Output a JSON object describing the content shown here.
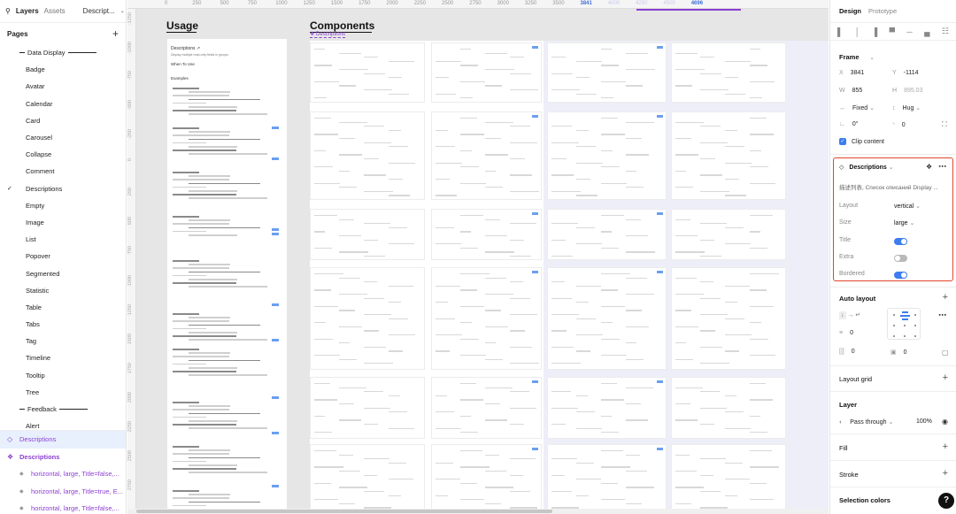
{
  "left_panel": {
    "tabs": {
      "layers": "Layers",
      "assets": "Assets",
      "page": "Descript..."
    },
    "pages_title": "Pages",
    "pages": [
      {
        "label": "Data Display",
        "type": "section"
      },
      {
        "label": "Badge"
      },
      {
        "label": "Avatar"
      },
      {
        "label": "Calendar"
      },
      {
        "label": "Card"
      },
      {
        "label": "Carousel"
      },
      {
        "label": "Collapse"
      },
      {
        "label": "Comment"
      },
      {
        "label": "Descriptions",
        "current": true
      },
      {
        "label": "Empty"
      },
      {
        "label": "Image"
      },
      {
        "label": "List"
      },
      {
        "label": "Popover"
      },
      {
        "label": "Segmented"
      },
      {
        "label": "Statistic"
      },
      {
        "label": "Table"
      },
      {
        "label": "Tabs"
      },
      {
        "label": "Tag"
      },
      {
        "label": "Timeline"
      },
      {
        "label": "Tooltip"
      },
      {
        "label": "Tree"
      },
      {
        "label": "Feedback",
        "type": "section"
      },
      {
        "label": "Alert"
      }
    ],
    "layers": [
      {
        "label": "Descriptions",
        "selected": true,
        "kind": "instance"
      },
      {
        "label": "Descriptions",
        "kind": "component-set"
      },
      {
        "label": "horizontal, large, Title=false,...",
        "kind": "variant"
      },
      {
        "label": "horizontal, large, Title=true, E...",
        "kind": "variant"
      },
      {
        "label": "horizontal, large, Title=false,...",
        "kind": "variant"
      }
    ]
  },
  "canvas": {
    "ruler_ticks": [
      "0",
      "250",
      "500",
      "750",
      "1000",
      "1250",
      "1500",
      "1750",
      "2000",
      "2250",
      "2500",
      "2750",
      "3000",
      "3250",
      "3500",
      "3841",
      "4000",
      "4250",
      "4500",
      "4696"
    ],
    "ruler_left_ticks": [
      "-1250",
      "-1000",
      "-750",
      "-500",
      "-250",
      "0",
      "250",
      "500",
      "750",
      "1000",
      "1250",
      "1500",
      "1750",
      "2000",
      "2250",
      "2500",
      "2750"
    ],
    "usage_title": "Usage",
    "components_title": "Components",
    "components_tag": "Descriptions",
    "usage_doc": {
      "title": "Descriptions",
      "subtitle": "Display multiple read-only fields in groups.",
      "when_to_use": "When To Use",
      "examples": "Examples"
    }
  },
  "right_panel": {
    "tabs": {
      "design": "Design",
      "prototype": "Prototype"
    },
    "frame_title": "Frame",
    "x": {
      "label": "X",
      "value": "3841"
    },
    "y": {
      "label": "Y",
      "value": "-1114"
    },
    "w": {
      "label": "W",
      "value": "855"
    },
    "h": {
      "label": "H",
      "value": "895.03"
    },
    "width_mode": "Fixed",
    "height_mode": "Hug",
    "rotation": "0°",
    "radius": "0",
    "clip_content": "Clip content",
    "component": {
      "name": "Descriptions",
      "description": "描述列表, Список описаний Display ...",
      "props": [
        {
          "key": "Layout",
          "value": "vertical",
          "type": "select"
        },
        {
          "key": "Size",
          "value": "large",
          "type": "select"
        },
        {
          "key": "Title",
          "value": true,
          "type": "toggle"
        },
        {
          "key": "Extra",
          "value": false,
          "type": "toggle"
        },
        {
          "key": "Bordered",
          "value": true,
          "type": "toggle"
        }
      ]
    },
    "auto_layout": {
      "title": "Auto layout",
      "spacing": "0",
      "padding_h": "0",
      "padding_v": "0"
    },
    "layout_grid": "Layout grid",
    "layer": {
      "title": "Layer",
      "blend": "Pass through",
      "opacity": "100%"
    },
    "fill": "Fill",
    "stroke": "Stroke",
    "selection_colors": "Selection colors",
    "help": "?"
  },
  "colors": {
    "accent": "#3c7df0",
    "component": "#8b3fd1",
    "highlight": "#e1452b",
    "canvas": "#e6e6e6"
  }
}
